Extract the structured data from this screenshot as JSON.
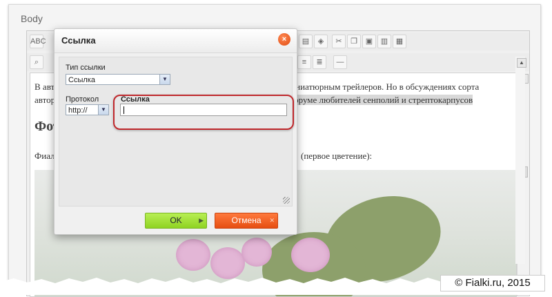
{
  "page": {
    "body_label": "Body"
  },
  "editor": {
    "para1_a": "В авт",
    "para1_b": "иниатюрным трейлеров. Но в обсуждениях сорта",
    "para1_c": "автор",
    "para1_hl": "оруме любителей сенполий и стрептокарпусов",
    "heading": "Фот",
    "para2_a": "Фиал",
    "para2_b": "(первое цветение):",
    "toolbar_spell": "ABC"
  },
  "dialog": {
    "title": "Ссылка",
    "close_glyph": "×",
    "link_type_label": "Тип ссылки",
    "link_type_value": "Ссылка",
    "protocol_label": "Протокол",
    "protocol_value": "http://",
    "url_label": "Ссылка",
    "url_value": "",
    "ok_label": "OK",
    "cancel_label": "Отмена"
  },
  "watermark": {
    "text": "© Fialki.ru, 2015"
  },
  "colors": {
    "ok": "#8fd322",
    "cancel": "#e64e12",
    "highlight_ring": "#c0282c"
  }
}
